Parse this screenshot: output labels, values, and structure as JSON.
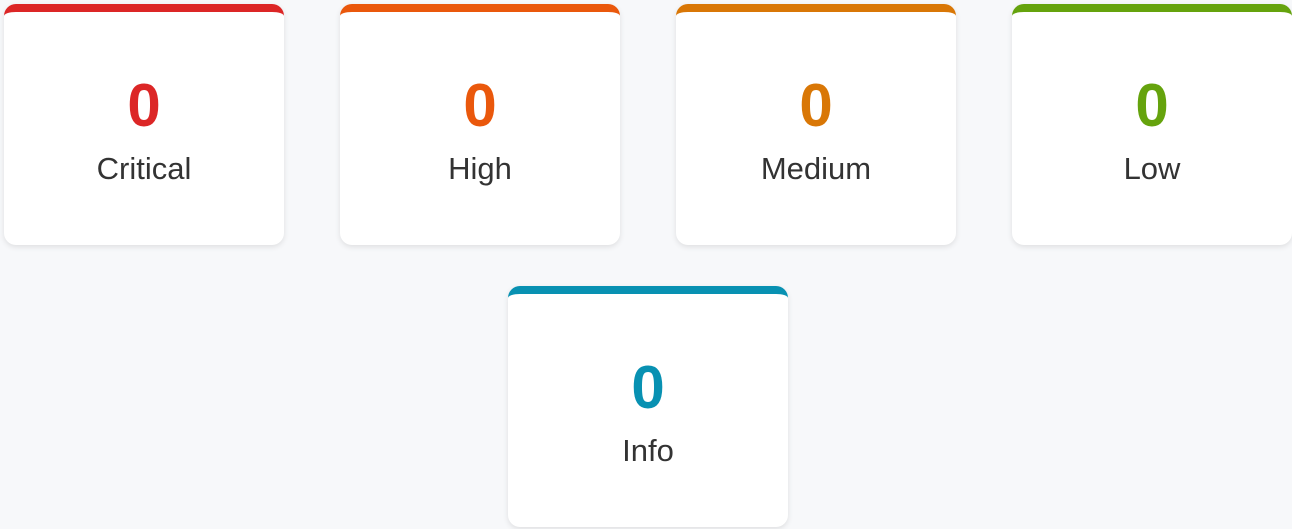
{
  "severity_cards": [
    {
      "key": "critical",
      "count": "0",
      "label": "Critical",
      "color": "#dc2626"
    },
    {
      "key": "high",
      "count": "0",
      "label": "High",
      "color": "#ea580c"
    },
    {
      "key": "medium",
      "count": "0",
      "label": "Medium",
      "color": "#d97706"
    },
    {
      "key": "low",
      "count": "0",
      "label": "Low",
      "color": "#65a30d"
    },
    {
      "key": "info",
      "count": "0",
      "label": "Info",
      "color": "#0891b2"
    }
  ]
}
